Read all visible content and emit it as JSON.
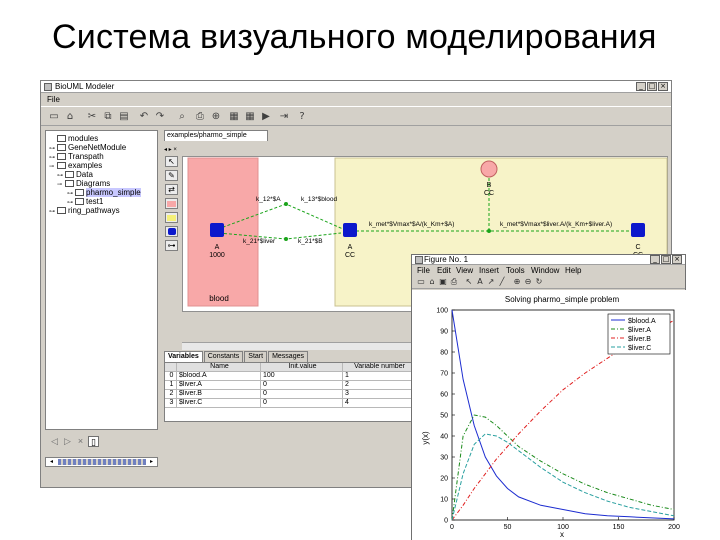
{
  "slide": {
    "title": "Система визуального моделирования"
  },
  "main_window": {
    "title": "BioUML Modeler",
    "menu": [
      "File"
    ],
    "buttons": {
      "minimize": "_",
      "maximize": "□",
      "close": "×"
    }
  },
  "tree": {
    "items": [
      {
        "label": "modules",
        "level": 0,
        "toggle": ""
      },
      {
        "label": "GeneNetModule",
        "level": 1,
        "toggle": "⊶"
      },
      {
        "label": "Transpath",
        "level": 1,
        "toggle": "⊶"
      },
      {
        "label": "examples",
        "level": 1,
        "toggle": "⊸"
      },
      {
        "label": "Data",
        "level": 2,
        "toggle": "⊶"
      },
      {
        "label": "Diagrams",
        "level": 2,
        "toggle": "⊸"
      },
      {
        "label": "pharmo_simple",
        "level": 3,
        "toggle": "⊶",
        "selected": true
      },
      {
        "label": "test1",
        "level": 3,
        "toggle": "⊶"
      },
      {
        "label": "ring_pathways",
        "level": 1,
        "toggle": "⊶"
      }
    ]
  },
  "editor": {
    "tab": "examples/pharmo_simple",
    "palette_header": "◂ ▸ ×",
    "compartments": {
      "blood": "blood",
      "liver": ""
    },
    "species": {
      "blood_a": "A\n1000",
      "liver_a": "A\nCC",
      "liver_c": "C\nCC",
      "top": "B\nCC"
    },
    "reactions": {
      "r1": "k_12*$A",
      "r2": "k_13*$blood",
      "r3": "k_21*$liver",
      "r4": "k_21*$B",
      "r5": "k_met*$Vmax*$A/(k_Km+$A)",
      "r6": "k_met*$Vmax*$liver.A/(k_Km+$liver.A)"
    }
  },
  "bottom": {
    "tabs": [
      "Variables",
      "Constants",
      "Start",
      "Messages"
    ],
    "columns": [
      "",
      "Name",
      "Init.value",
      "Variable number"
    ],
    "rows": [
      [
        "0",
        "$blood.A",
        "100",
        "1"
      ],
      [
        "1",
        "$liver.A",
        "0",
        "2"
      ],
      [
        "2",
        "$liver.B",
        "0",
        "3"
      ],
      [
        "3",
        "$liver.C",
        "0",
        "4"
      ]
    ]
  },
  "figure_window": {
    "title": "Figure No. 1",
    "menu": [
      "File",
      "Edit",
      "View",
      "Insert",
      "Tools",
      "Window",
      "Help"
    ],
    "buttons": {
      "minimize": "_",
      "maximize": "□",
      "close": "×"
    }
  },
  "chart_data": {
    "type": "line",
    "title": "Solving pharmo_simple problem",
    "xlabel": "x",
    "ylabel": "y(x)",
    "xlim": [
      0,
      200
    ],
    "ylim": [
      0,
      100
    ],
    "xticks": [
      0,
      50,
      100,
      150,
      200
    ],
    "yticks": [
      0,
      10,
      20,
      30,
      40,
      50,
      60,
      70,
      80,
      90,
      100
    ],
    "legend_position": "top-right",
    "x": [
      0,
      10,
      20,
      30,
      40,
      50,
      60,
      80,
      100,
      120,
      140,
      160,
      180,
      200
    ],
    "series": [
      {
        "name": "$blood.A",
        "color": "#1c2cd0",
        "style": "solid",
        "values": [
          100,
          67,
          45,
          30,
          21,
          15,
          11,
          7,
          5,
          3,
          2,
          1.5,
          1,
          0.5
        ]
      },
      {
        "name": "$liver.A",
        "color": "#1a8a1a",
        "style": "dashdot",
        "values": [
          0,
          40,
          50,
          49,
          45,
          40,
          35,
          28,
          22,
          17,
          13,
          10,
          7,
          5
        ]
      },
      {
        "name": "$liver.B",
        "color": "#e02020",
        "style": "dashdot",
        "values": [
          0,
          7,
          15,
          22,
          29,
          35,
          41,
          52,
          62,
          70,
          77,
          84,
          90,
          95
        ]
      },
      {
        "name": "$liver.C",
        "color": "#2aa0a0",
        "style": "dashed",
        "values": [
          0,
          22,
          36,
          41,
          40,
          37,
          33,
          25,
          18,
          13,
          9,
          6,
          4,
          2
        ]
      }
    ]
  }
}
